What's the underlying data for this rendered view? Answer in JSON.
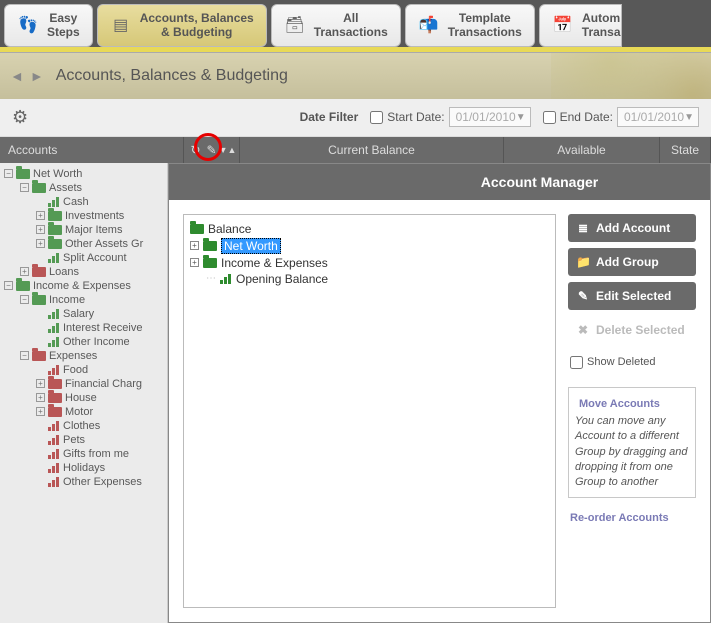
{
  "tabs": [
    {
      "label": "Easy\nSteps",
      "icon": "👣"
    },
    {
      "label": "Accounts, Balances\n& Budgeting",
      "icon": "▤"
    },
    {
      "label": "All\nTransactions",
      "icon": "🗃"
    },
    {
      "label": "Template\nTransactions",
      "icon": "📬"
    },
    {
      "label": "Autom\nTransa",
      "icon": "📅"
    }
  ],
  "banner": {
    "title": "Accounts, Balances & Budgeting"
  },
  "filter": {
    "label": "Date Filter",
    "start_label": "Start Date:",
    "end_label": "End Date:",
    "start_value": "01/01/2010",
    "end_value": "01/01/2010"
  },
  "columns": {
    "accounts": "Accounts",
    "balance": "Current Balance",
    "available": "Available",
    "state": "State"
  },
  "tree": [
    {
      "ind": 1,
      "exp": "−",
      "type": "folder",
      "color": "green",
      "label": "Net Worth"
    },
    {
      "ind": 2,
      "exp": "−",
      "type": "folder",
      "color": "green",
      "label": "Assets"
    },
    {
      "ind": 3,
      "exp": "",
      "type": "bar",
      "color": "green",
      "label": "Cash"
    },
    {
      "ind": 3,
      "exp": "+",
      "type": "folder",
      "color": "green",
      "label": "Investments"
    },
    {
      "ind": 3,
      "exp": "+",
      "type": "folder",
      "color": "green",
      "label": "Major Items"
    },
    {
      "ind": 3,
      "exp": "+",
      "type": "folder",
      "color": "green",
      "label": "Other Assets Gr"
    },
    {
      "ind": 3,
      "exp": "",
      "type": "bar",
      "color": "green",
      "label": "Split Account"
    },
    {
      "ind": 2,
      "exp": "+",
      "type": "folder",
      "color": "red",
      "label": "Loans"
    },
    {
      "ind": 1,
      "exp": "−",
      "type": "folder",
      "color": "green",
      "label": "Income & Expenses"
    },
    {
      "ind": 2,
      "exp": "−",
      "type": "folder",
      "color": "green",
      "label": "Income"
    },
    {
      "ind": 3,
      "exp": "",
      "type": "bar",
      "color": "green",
      "label": "Salary"
    },
    {
      "ind": 3,
      "exp": "",
      "type": "bar",
      "color": "green",
      "label": "Interest Receive"
    },
    {
      "ind": 3,
      "exp": "",
      "type": "bar",
      "color": "green",
      "label": "Other Income"
    },
    {
      "ind": 2,
      "exp": "−",
      "type": "folder",
      "color": "red",
      "label": "Expenses"
    },
    {
      "ind": 3,
      "exp": "",
      "type": "bar",
      "color": "red",
      "label": "Food"
    },
    {
      "ind": 3,
      "exp": "+",
      "type": "folder",
      "color": "red",
      "label": "Financial Charg"
    },
    {
      "ind": 3,
      "exp": "+",
      "type": "folder",
      "color": "red",
      "label": "House"
    },
    {
      "ind": 3,
      "exp": "+",
      "type": "folder",
      "color": "red",
      "label": "Motor"
    },
    {
      "ind": 3,
      "exp": "",
      "type": "bar",
      "color": "red",
      "label": "Clothes"
    },
    {
      "ind": 3,
      "exp": "",
      "type": "bar",
      "color": "red",
      "label": "Pets"
    },
    {
      "ind": 3,
      "exp": "",
      "type": "bar",
      "color": "red",
      "label": "Gifts from me"
    },
    {
      "ind": 3,
      "exp": "",
      "type": "bar",
      "color": "red",
      "label": "Holidays"
    },
    {
      "ind": 3,
      "exp": "",
      "type": "bar",
      "color": "red",
      "label": "Other Expenses"
    }
  ],
  "modal": {
    "title": "Account Manager",
    "tree": {
      "root": "Balance",
      "net_worth": "Net Worth",
      "income_expenses": "Income & Expenses",
      "opening_balance": "Opening Balance"
    },
    "buttons": {
      "add_account": "Add Account",
      "add_group": "Add Group",
      "edit_selected": "Edit Selected",
      "delete_selected": "Delete Selected"
    },
    "show_deleted": "Show Deleted",
    "move": {
      "legend": "Move Accounts",
      "text": "You can move any Account to a different Group by dragging and dropping it from one Group to another"
    },
    "reorder_legend": "Re-order Accounts"
  }
}
